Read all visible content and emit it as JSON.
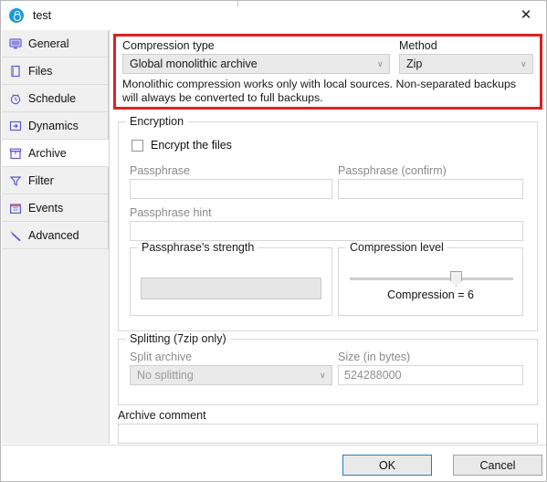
{
  "window": {
    "title": "test",
    "icon": "app-clock-icon",
    "close_label": "✕"
  },
  "sidebar": {
    "items": [
      {
        "label": "General",
        "icon": "monitor-icon",
        "selected": false
      },
      {
        "label": "Files",
        "icon": "file-icon",
        "selected": false
      },
      {
        "label": "Schedule",
        "icon": "clock-icon",
        "selected": false
      },
      {
        "label": "Dynamics",
        "icon": "arrow-box-icon",
        "selected": false
      },
      {
        "label": "Archive",
        "icon": "box-icon",
        "selected": true
      },
      {
        "label": "Filter",
        "icon": "funnel-icon",
        "selected": false
      },
      {
        "label": "Events",
        "icon": "calendar-icon",
        "selected": false
      },
      {
        "label": "Advanced",
        "icon": "wrench-icon",
        "selected": false
      }
    ]
  },
  "highlight": {
    "border_color": "#e02020",
    "compression_type": {
      "label": "Compression type",
      "value": "Global monolithic archive",
      "chevron": "∨"
    },
    "method": {
      "label": "Method",
      "value": "Zip",
      "chevron": "∨"
    },
    "note": "Monolithic compression works only with local sources. Non-separated backups will always be converted to full backups."
  },
  "encryption": {
    "group_title": "Encryption",
    "encrypt_checkbox_label": "Encrypt the files",
    "encrypt_checked": false,
    "passphrase": {
      "label": "Passphrase",
      "value": ""
    },
    "passphrase_confirm": {
      "label": "Passphrase (confirm)",
      "value": ""
    },
    "passphrase_hint": {
      "label": "Passphrase hint",
      "value": ""
    },
    "strength": {
      "group_title": "Passphrase's strength",
      "value": ""
    },
    "compression_level": {
      "group_title": "Compression level",
      "caption": "Compression = 6",
      "value": 6,
      "min": 0,
      "max": 9
    }
  },
  "splitting": {
    "group_title": "Splitting (7zip only)",
    "split_archive": {
      "label": "Split archive",
      "value": "No splitting",
      "chevron": "∨"
    },
    "size": {
      "label": "Size (in bytes)",
      "value": "524288000"
    }
  },
  "archive_comment": {
    "label": "Archive comment",
    "value": ""
  },
  "footer": {
    "ok_label": "OK",
    "cancel_label": "Cancel"
  }
}
